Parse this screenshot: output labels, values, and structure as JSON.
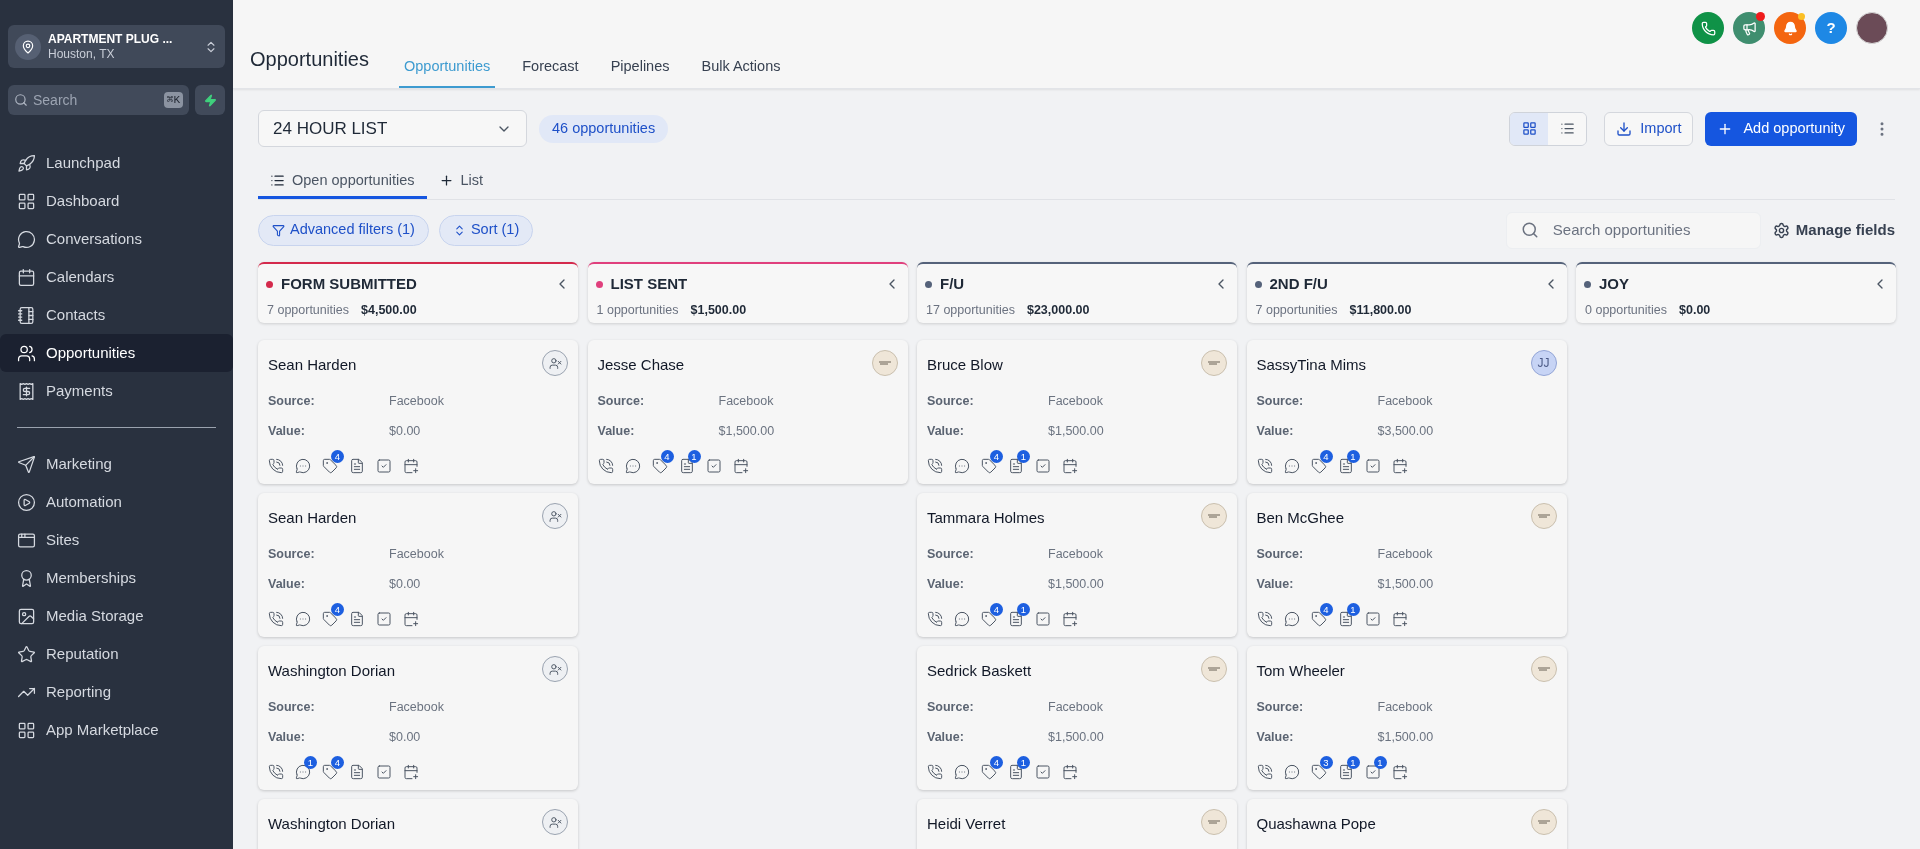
{
  "sidebar": {
    "location": {
      "name": "APARTMENT PLUG ...",
      "city": "Houston, TX"
    },
    "search": {
      "placeholder": "Search",
      "shortcut": "⌘K"
    },
    "nav_main": [
      {
        "label": "Launchpad",
        "selected": false
      },
      {
        "label": "Dashboard",
        "selected": false
      },
      {
        "label": "Conversations",
        "selected": false
      },
      {
        "label": "Calendars",
        "selected": false
      },
      {
        "label": "Contacts",
        "selected": false
      },
      {
        "label": "Opportunities",
        "selected": true
      },
      {
        "label": "Payments",
        "selected": false
      }
    ],
    "nav_more": [
      {
        "label": "Marketing",
        "selected": false
      },
      {
        "label": "Automation",
        "selected": false
      },
      {
        "label": "Sites",
        "selected": false
      },
      {
        "label": "Memberships",
        "selected": false
      },
      {
        "label": "Media Storage",
        "selected": false
      },
      {
        "label": "Reputation",
        "selected": false
      },
      {
        "label": "Reporting",
        "selected": false
      },
      {
        "label": "App Marketplace",
        "selected": false
      }
    ]
  },
  "header": {
    "title": "Opportunities",
    "help_label": "?",
    "tabs": [
      {
        "label": "Opportunities",
        "selected": true
      },
      {
        "label": "Forecast",
        "selected": false
      },
      {
        "label": "Pipelines",
        "selected": false
      },
      {
        "label": "Bulk Actions",
        "selected": false
      }
    ]
  },
  "toolbar": {
    "pipeline": "24 HOUR LIST",
    "count": "46 opportunities",
    "views": [
      {
        "kind": "grid",
        "selected": true
      },
      {
        "kind": "list",
        "selected": false
      }
    ],
    "import": "Import",
    "add": "Add opportunity"
  },
  "subtabs": [
    {
      "label": "Open opportunities",
      "kind": "list",
      "selected": true
    },
    {
      "label": "List",
      "kind": "add",
      "selected": false
    }
  ],
  "filters": [
    {
      "label": "Advanced filters (1)",
      "kind": "filter"
    },
    {
      "label": "Sort (1)",
      "kind": "sort"
    }
  ],
  "search": {
    "placeholder": "Search opportunities"
  },
  "manage_fields": "Manage fields",
  "columns": [
    {
      "name": "FORM SUBMITTED",
      "color": "#d42a4c",
      "count": "7 opportunities",
      "total": "$4,500.00",
      "cards": [
        {
          "name": "Sean Harden",
          "avatar": {
            "kind": "unassigned"
          },
          "fields": [
            {
              "label": "Source:",
              "value": "Facebook"
            },
            {
              "label": "Value:",
              "value": "$0.00"
            }
          ],
          "badges": {
            "tags": "4"
          }
        },
        {
          "name": "Sean Harden",
          "avatar": {
            "kind": "unassigned"
          },
          "fields": [
            {
              "label": "Source:",
              "value": "Facebook"
            },
            {
              "label": "Value:",
              "value": "$0.00"
            }
          ],
          "badges": {
            "tags": "4"
          }
        },
        {
          "name": "Washington Dorian",
          "avatar": {
            "kind": "unassigned"
          },
          "fields": [
            {
              "label": "Source:",
              "value": "Facebook"
            },
            {
              "label": "Value:",
              "value": "$0.00"
            }
          ],
          "badges": {
            "messages": "1",
            "tags": "4"
          }
        },
        {
          "name": "Washington Dorian",
          "avatar": {
            "kind": "unassigned"
          }
        }
      ]
    },
    {
      "name": "LIST SENT",
      "color": "#e0407d",
      "count": "1 opportunities",
      "total": "$1,500.00",
      "cards": [
        {
          "name": "Jesse Chase",
          "avatar": {
            "kind": "logo"
          },
          "fields": [
            {
              "label": "Source:",
              "value": "Facebook"
            },
            {
              "label": "Value:",
              "value": "$1,500.00"
            }
          ],
          "badges": {
            "tags": "4",
            "notes": "1"
          }
        }
      ]
    },
    {
      "name": "F/U",
      "color": "#55627a",
      "count": "17 opportunities",
      "total": "$23,000.00",
      "cards": [
        {
          "name": "Bruce Blow",
          "avatar": {
            "kind": "logo"
          },
          "fields": [
            {
              "label": "Source:",
              "value": "Facebook"
            },
            {
              "label": "Value:",
              "value": "$1,500.00"
            }
          ],
          "badges": {
            "tags": "4",
            "notes": "1"
          }
        },
        {
          "name": "Tammara Holmes",
          "avatar": {
            "kind": "logo"
          },
          "fields": [
            {
              "label": "Source:",
              "value": "Facebook"
            },
            {
              "label": "Value:",
              "value": "$1,500.00"
            }
          ],
          "badges": {
            "tags": "4",
            "notes": "1"
          }
        },
        {
          "name": "Sedrick Baskett",
          "avatar": {
            "kind": "logo"
          },
          "fields": [
            {
              "label": "Source:",
              "value": "Facebook"
            },
            {
              "label": "Value:",
              "value": "$1,500.00"
            }
          ],
          "badges": {
            "tags": "4",
            "notes": "1"
          }
        },
        {
          "name": "Heidi Verret",
          "avatar": {
            "kind": "logo"
          }
        }
      ]
    },
    {
      "name": "2ND F/U",
      "color": "#55627a",
      "count": "7 opportunities",
      "total": "$11,800.00",
      "cards": [
        {
          "name": "SassyTina Mims",
          "avatar": {
            "kind": "initials",
            "text": "JJ"
          },
          "fields": [
            {
              "label": "Source:",
              "value": "Facebook"
            },
            {
              "label": "Value:",
              "value": "$3,500.00"
            }
          ],
          "badges": {
            "tags": "4",
            "notes": "1"
          }
        },
        {
          "name": "Ben McGhee",
          "avatar": {
            "kind": "logo"
          },
          "fields": [
            {
              "label": "Source:",
              "value": "Facebook"
            },
            {
              "label": "Value:",
              "value": "$1,500.00"
            }
          ],
          "badges": {
            "tags": "4",
            "notes": "1"
          }
        },
        {
          "name": "Tom Wheeler",
          "avatar": {
            "kind": "logo"
          },
          "fields": [
            {
              "label": "Source:",
              "value": "Facebook"
            },
            {
              "label": "Value:",
              "value": "$1,500.00"
            }
          ],
          "badges": {
            "tags": "3",
            "notes": "1",
            "tasks": "1"
          }
        },
        {
          "name": "Quashawna Pope",
          "avatar": {
            "kind": "logo"
          }
        }
      ]
    },
    {
      "name": "JOY",
      "color": "#55627a",
      "count": "0 opportunities",
      "total": "$0.00"
    }
  ]
}
